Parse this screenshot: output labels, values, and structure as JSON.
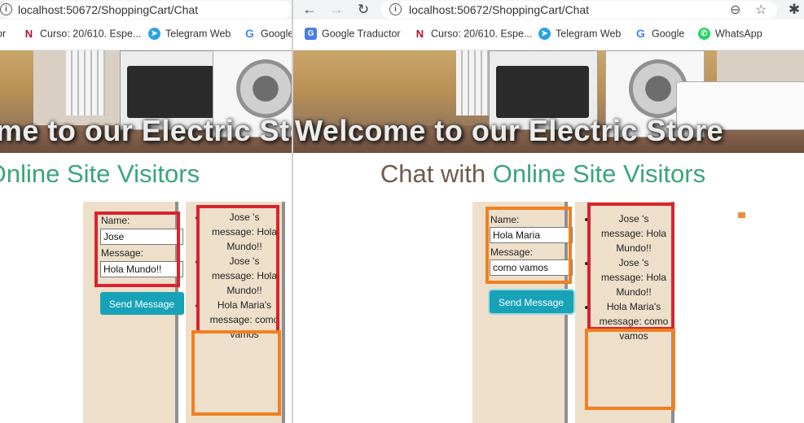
{
  "browser": {
    "url": "localhost:50672/ShoppingCart/Chat",
    "bookmarks": {
      "translator": "Google Traductor",
      "curso": "Curso: 20/610. Espe...",
      "telegram": "Telegram Web",
      "google": "Google",
      "whatsapp": "WhatsApp",
      "left_partial_first": "or",
      "left_partial_google": "Google"
    }
  },
  "page": {
    "hero_title": "Welcome to our Electric Store",
    "chat_title_a": "Chat with ",
    "chat_title_b": "Online Site Visitors",
    "name_label": "Name:",
    "message_label": "Message:",
    "send_label": "Send Message"
  },
  "left_window": {
    "name_value": "Jose",
    "message_value": "Hola Mundo!!"
  },
  "right_window": {
    "name_value": "Hola Maria",
    "message_value": "como vamos"
  },
  "messages": [
    "Jose 's message: Hola Mundo!!",
    "Jose 's message: Hola Mundo!!",
    "Hola Maria's message: como vamos"
  ],
  "colors": {
    "accent_green": "#3aa57a",
    "send_button": "#17a2b8",
    "panel_bg": "#eedfca",
    "highlight_red": "#d9232e",
    "highlight_orange": "#f08020"
  }
}
